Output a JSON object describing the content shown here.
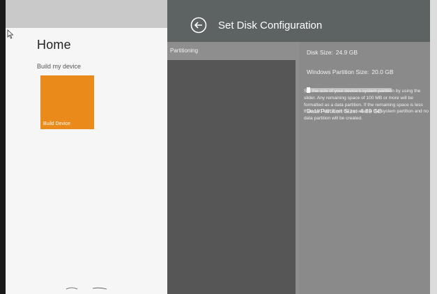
{
  "home": {
    "title": "Home",
    "subtitle": "Build my device",
    "tile": {
      "label": "Build Device",
      "color": "#ea8a1a"
    }
  },
  "config": {
    "title": "Set Disk Configuration",
    "back_icon": "back-arrow-circle-icon",
    "partition_label": "Partitioning",
    "disk_size": {
      "label": "Disk Size:",
      "value": "24.9 GB"
    },
    "windows_partition": {
      "label": "Windows Partition Size:",
      "value": "20.0 GB"
    },
    "data_partition": {
      "label": "Data Partition Size:",
      "value": "4.89 GB"
    },
    "slider_fraction": 0.02,
    "description": "Set the size of your device's system partition by using the slider. Any remaining space of 100 MB or more will be formatted as a data partition. If the remaining space is less than 100 MB, it will be included in the system partition and no data partition will be created."
  }
}
